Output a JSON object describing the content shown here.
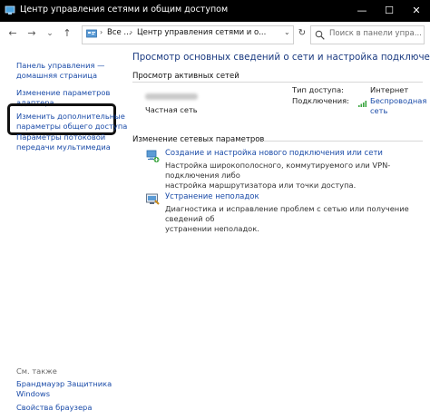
{
  "window": {
    "title": "Центр управления сетями и общим доступом",
    "minimize": "—",
    "maximize": "☐",
    "close": "✕"
  },
  "address_bar": {
    "back": "←",
    "forward": "→",
    "recent": "⌄",
    "up": "↑",
    "crumb_root": "Все ...",
    "crumb_current": "Центр управления сетями и о...",
    "dropdown": "⌄",
    "refresh": "↻",
    "search_placeholder": "Поиск в панели упра..."
  },
  "sidebar": {
    "home_line1": "Панель управления —",
    "home_line2": "домашняя страница",
    "adapter_line1": "Изменение параметров",
    "adapter_line2": "адаптера",
    "sharing_line1": "Изменить дополнительные",
    "sharing_line2": "параметры общего доступа",
    "stream_line1": "Параметры потоковой",
    "stream_line2": "передачи мультимедиа",
    "see_also": "См. также",
    "firewall_line1": "Брандмауэр Защитника",
    "firewall_line2": "Windows",
    "browser": "Свойства браузера"
  },
  "main": {
    "title": "Просмотр основных сведений о сети и настройка подключений",
    "active_networks_heading": "Просмотр активных сетей",
    "network_type": "Частная сеть",
    "access_type_label": "Тип доступа:",
    "access_type_value": "Интернет",
    "connections_label": "Подключения:",
    "connection_line1": "Беспроводная",
    "connection_line2": "сеть",
    "change_settings_heading": "Изменение сетевых параметров",
    "task1_link": "Создание и настройка нового подключения или сети",
    "task1_desc_line1": "Настройка широкополосного, коммутируемого или VPN-подключения либо",
    "task1_desc_line2": "настройка маршрутизатора или точки доступа.",
    "task2_link": "Устранение неполадок",
    "task2_desc_line1": "Диагностика и исправление проблем с сетью или получение сведений об",
    "task2_desc_line2": "устранении неполадок."
  }
}
